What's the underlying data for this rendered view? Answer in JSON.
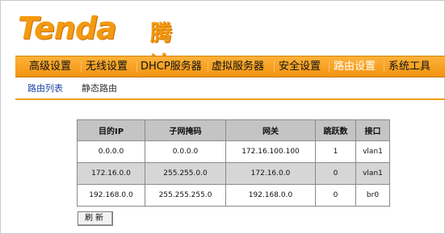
{
  "brand": {
    "logo_latin": "Tenda",
    "logo_cn": "腾达",
    "color": "#f39a10"
  },
  "nav": {
    "items": [
      {
        "label": "高级设置",
        "active": false
      },
      {
        "label": "无线设置",
        "active": false
      },
      {
        "label": "DHCP服务器",
        "active": false
      },
      {
        "label": "虚拟服务器",
        "active": false
      },
      {
        "label": "安全设置",
        "active": false
      },
      {
        "label": "路由设置",
        "active": true
      },
      {
        "label": "系统工具",
        "active": false
      }
    ]
  },
  "subnav": {
    "items": [
      {
        "label": "路由列表",
        "active": true
      },
      {
        "label": "静态路由",
        "active": false
      }
    ]
  },
  "route_table": {
    "headers": [
      "目的IP",
      "子网掩码",
      "网关",
      "跳跃数",
      "接口"
    ],
    "rows": [
      [
        "0.0.0.0",
        "0.0.0.0",
        "172.16.100.100",
        "1",
        "vlan1"
      ],
      [
        "172.16.0.0",
        "255.255.0.0",
        "172.16.0.0",
        "0",
        "vlan1"
      ],
      [
        "192.168.0.0",
        "255.255.255.0",
        "192.168.0.0",
        "0",
        "br0"
      ]
    ]
  },
  "refresh_label": "刷新"
}
